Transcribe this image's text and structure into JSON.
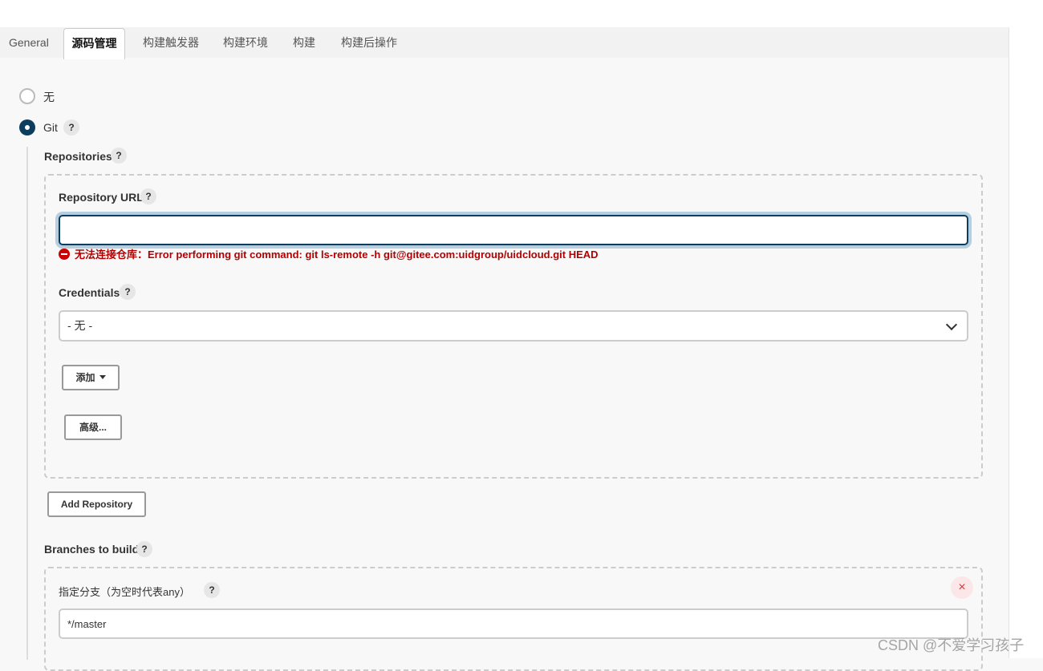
{
  "tabs": [
    "General",
    "源码管理",
    "构建触发器",
    "构建环境",
    "构建",
    "构建后操作"
  ],
  "scm": {
    "option_none": "无",
    "option_git": "Git",
    "selected": "Git"
  },
  "repositories": {
    "label": "Repositories",
    "url_label": "Repository URL",
    "url_value": "",
    "error_message": "无法连接仓库：Error performing git command: git ls-remote -h git@gitee.com:uidgroup/uidcloud.git HEAD",
    "credentials_label": "Credentials",
    "credentials_selected": "- 无 -",
    "add_button": "添加",
    "advanced_button": "高级...",
    "add_repository_button": "Add Repository"
  },
  "branches": {
    "label": "Branches to build",
    "specifier_label": "指定分支（为空时代表any）",
    "specifier_value": "*/master",
    "remove_symbol": "×"
  },
  "help_symbol": "?",
  "watermark": "CSDN @不爱学习孩子",
  "icons": [
    "help-icon",
    "error-icon",
    "chevron-down-icon",
    "caret-down-icon",
    "close-icon"
  ],
  "colors": {
    "accent": "#0c3c5e",
    "error": "#b40000",
    "focus_ring": "#b6cfe0"
  }
}
